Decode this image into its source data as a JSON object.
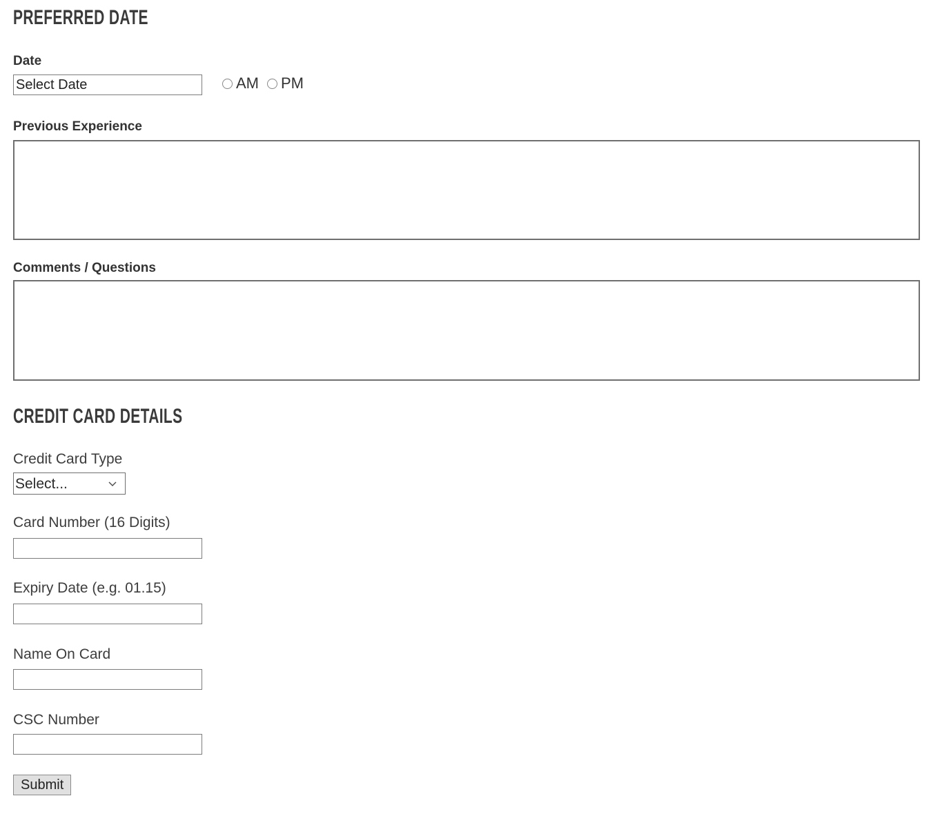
{
  "page": {
    "background": "#ffffff",
    "text_color": "#333333",
    "border_color": "#7c7c7c"
  },
  "preferred_date_section": {
    "heading": "Preferred Date",
    "date_field": {
      "label": "Date",
      "value": "Select Date",
      "placeholder": "Select Date"
    },
    "time_of_day": {
      "options": [
        {
          "label": "AM",
          "selected": false
        },
        {
          "label": "PM",
          "selected": false
        }
      ]
    },
    "previous_experience": {
      "label": "Previous Experience",
      "value": "",
      "placeholder": ""
    },
    "comments_questions": {
      "label": "Comments / Questions",
      "value": "",
      "placeholder": ""
    }
  },
  "credit_card_section": {
    "heading": "Credit Card Details",
    "card_type": {
      "label": "Credit Card Type",
      "selected": "Select...",
      "options": [
        "Select..."
      ]
    },
    "card_number": {
      "label": "Card Number (16 Digits)",
      "value": "",
      "placeholder": ""
    },
    "expiry_date": {
      "label": "Expiry Date (e.g. 01.15)",
      "value": "",
      "placeholder": ""
    },
    "name_on_card": {
      "label": "Name On Card",
      "value": "",
      "placeholder": ""
    },
    "csc_number": {
      "label": "CSC Number",
      "value": "",
      "placeholder": ""
    }
  },
  "actions": {
    "submit_label": "Submit"
  },
  "icons": {
    "chevron_down": "chevron-down-icon",
    "radio_unselected": "radio-unselected-icon"
  }
}
